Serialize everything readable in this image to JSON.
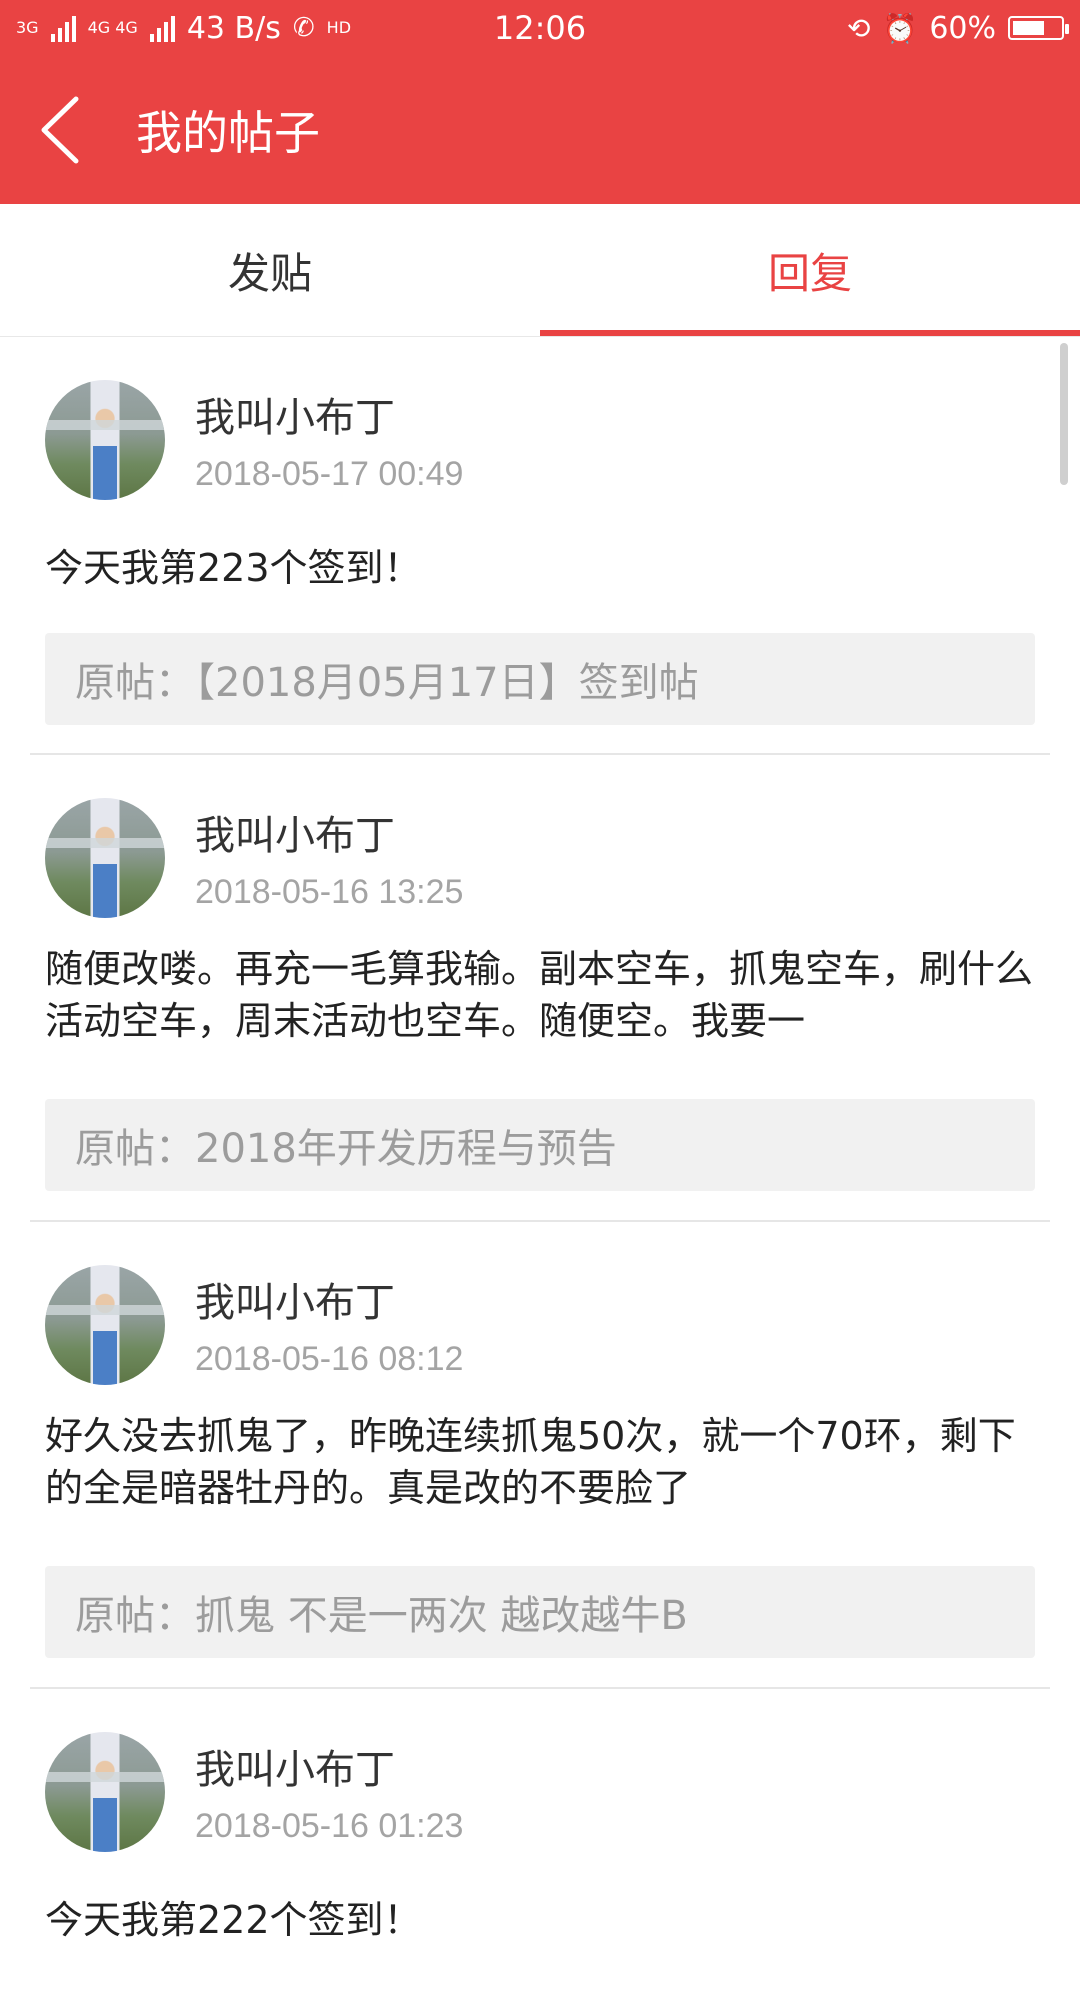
{
  "status": {
    "net1": "3G",
    "net2": "4G 4G",
    "speed": "43 B/s",
    "hd": "HD",
    "time": "12:06",
    "battery": "60%"
  },
  "nav": {
    "title": "我的帖子"
  },
  "tabs": [
    {
      "label": "发贴",
      "active": false
    },
    {
      "label": "回复",
      "active": true
    }
  ],
  "posts": [
    {
      "user": "我叫小布丁",
      "time": "2018-05-17 00:49",
      "content": "今天我第223个签到！",
      "original": "原帖：【2018月05月17日】签到帖"
    },
    {
      "user": "我叫小布丁",
      "time": "2018-05-16 13:25",
      "content": "随便改喽。再充一毛算我输。副本空车，抓鬼空车，刷什么活动空车，周末活动也空车。随便空。我要一",
      "original": "原帖：2018年开发历程与预告"
    },
    {
      "user": "我叫小布丁",
      "time": "2018-05-16 08:12",
      "content": "好久没去抓鬼了，昨晚连续抓鬼50次，就一个70环，剩下的全是暗器牡丹的。真是改的不要脸了",
      "original": "原帖：抓鬼 不是一两次 越改越牛B"
    },
    {
      "user": "我叫小布丁",
      "time": "2018-05-16 01:23",
      "content": "今天我第222个签到！",
      "original": ""
    }
  ],
  "colors": {
    "accent": "#E94343"
  }
}
